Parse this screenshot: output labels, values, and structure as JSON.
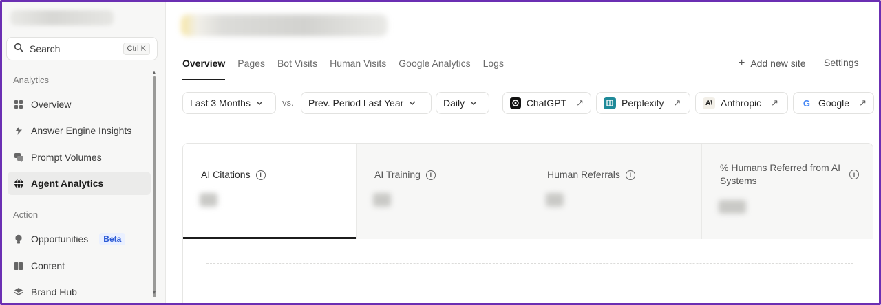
{
  "sidebar": {
    "search": {
      "label": "Search",
      "shortcut": "Ctrl K"
    },
    "sections": [
      {
        "label": "Analytics"
      },
      {
        "label": "Action"
      }
    ],
    "items": [
      {
        "label": "Overview",
        "icon": "grid-icon"
      },
      {
        "label": "Answer Engine Insights",
        "icon": "bolt-icon"
      },
      {
        "label": "Prompt Volumes",
        "icon": "chat-icon"
      },
      {
        "label": "Agent Analytics",
        "icon": "globe-icon",
        "active": true
      },
      {
        "label": "Opportunities",
        "icon": "lightbulb-icon",
        "badge": "Beta"
      },
      {
        "label": "Content",
        "icon": "book-icon"
      },
      {
        "label": "Brand Hub",
        "icon": "layers-icon"
      }
    ]
  },
  "main": {
    "tabs": [
      {
        "label": "Overview",
        "active": true
      },
      {
        "label": "Pages"
      },
      {
        "label": "Bot Visits"
      },
      {
        "label": "Human Visits"
      },
      {
        "label": "Google Analytics"
      },
      {
        "label": "Logs"
      }
    ],
    "add_site": "Add new site",
    "settings": "Settings",
    "filters": {
      "range": "Last 3 Months",
      "vs": "vs.",
      "compare": "Prev. Period Last Year",
      "granularity": "Daily"
    },
    "engines": [
      {
        "label": "ChatGPT",
        "icon": "chatgpt-icon"
      },
      {
        "label": "Perplexity",
        "icon": "perplexity-icon"
      },
      {
        "label": "Anthropic",
        "icon": "anthropic-icon"
      },
      {
        "label": "Google",
        "icon": "google-icon"
      }
    ],
    "metrics": [
      {
        "label": "AI Citations",
        "active": true
      },
      {
        "label": "AI Training"
      },
      {
        "label": "Human Referrals"
      },
      {
        "label": "% Humans Referred from AI Systems"
      }
    ]
  },
  "colors": {
    "frame": "#6b2fb3",
    "accent_beta": "#2c5bd6",
    "active_underline": "#1c1c1c"
  }
}
